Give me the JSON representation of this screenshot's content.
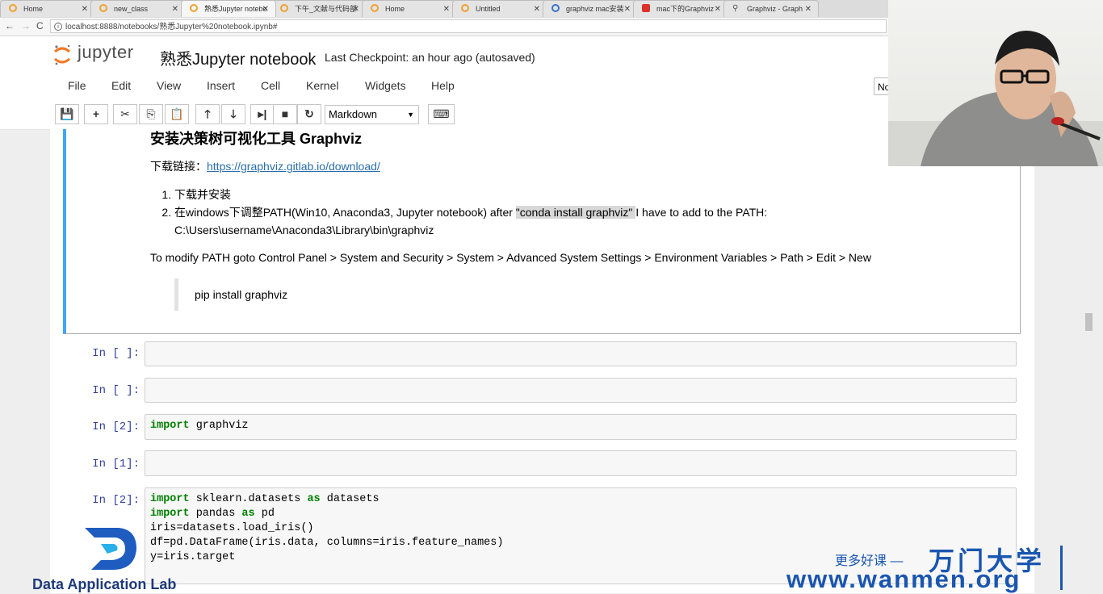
{
  "browser": {
    "tabs": [
      {
        "title": "Home",
        "icon": "jupyter-icon"
      },
      {
        "title": "new_class",
        "icon": "jupyter-icon"
      },
      {
        "title": "熟悉Jupyter notebo",
        "icon": "jupyter-icon",
        "active": true
      },
      {
        "title": "下午_文献与代码部",
        "icon": "jupyter-icon"
      },
      {
        "title": "Home",
        "icon": "jupyter-icon"
      },
      {
        "title": "Untitled",
        "icon": "jupyter-icon"
      },
      {
        "title": "graphviz mac安装",
        "icon": "gear-icon"
      },
      {
        "title": "mac下的Graphviz",
        "icon": "csdn-icon"
      },
      {
        "title": "Graphviz - Graph",
        "icon": "tree-icon"
      }
    ],
    "url": "localhost:8888/notebooks/熟悉Jupyter%20notebook.ipynb#"
  },
  "header": {
    "brand": "jupyter",
    "notebook_name": "熟悉Jupyter notebook",
    "checkpoint": "Last Checkpoint: an hour ago (autosaved)"
  },
  "menu": [
    "File",
    "Edit",
    "View",
    "Insert",
    "Cell",
    "Kernel",
    "Widgets",
    "Help"
  ],
  "kernel_indicator": "No",
  "toolbar": {
    "cell_type": "Markdown"
  },
  "markdown_cell": {
    "heading": "安装决策树可视化工具 Graphviz",
    "download_label": "下载链接：",
    "download_link": "https://graphviz.gitlab.io/download/",
    "list_item_1": "下载并安装",
    "list_item_2_prefix": "在windows下调整PATH(Win10, Anaconda3, Jupyter notebook) after ",
    "list_item_2_highlight": "\"conda install graphviz\" ",
    "list_item_2_suffix": "I have to add to the PATH:",
    "list_item_2_path": "C:\\Users\\username\\Anaconda3\\Library\\bin\\graphviz",
    "modify_path": "To modify PATH goto Control Panel > System and Security > System > Advanced System Settings > Environment Variables > Path > Edit > New",
    "blockquote": "pip install graphviz"
  },
  "cells": [
    {
      "prompt": "In [ ]:"
    },
    {
      "prompt": "In [ ]:"
    },
    {
      "prompt": "In [2]:",
      "kw": "import",
      "rest": " graphviz"
    },
    {
      "prompt": "In [1]:"
    },
    {
      "prompt": "In [2]:"
    }
  ],
  "last_cell": {
    "l1_kw": "import",
    "l1_mid": " sklearn.datasets ",
    "l1_kw2": "as",
    "l1_end": " datasets",
    "l2_kw": "import",
    "l2_mid": " pandas ",
    "l2_kw2": "as",
    "l2_end": " pd",
    "l3": "iris=datasets.load_iris()",
    "l4": "df=pd.DataFrame(iris.data, columns=iris.feature_names)",
    "l5": "y=iris.target"
  },
  "watermark": {
    "left_text": "Data Application Lab",
    "right_cn": "更多好课 —",
    "right_big": "万门大学",
    "right_url": "www.wanmen.org"
  }
}
